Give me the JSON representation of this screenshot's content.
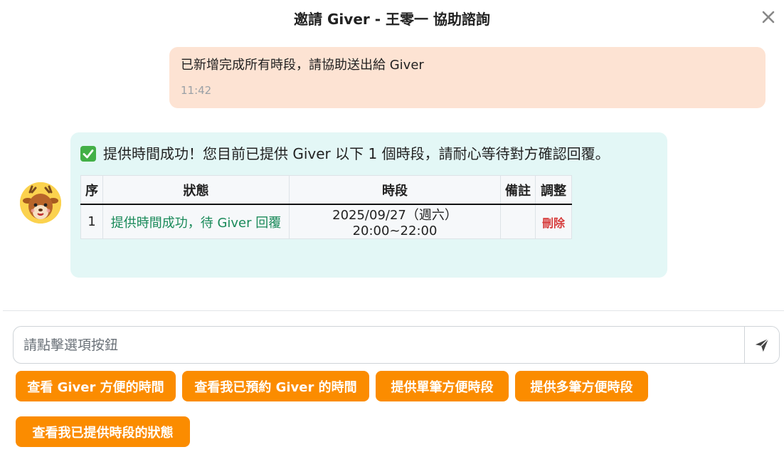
{
  "header": {
    "title": "邀請 Giver - 王零一 協助諮詢",
    "close_icon": "close-icon"
  },
  "messages": {
    "user": {
      "text": "已新增完成所有時段，請協助送出給 Giver",
      "time": "11:42"
    },
    "bot": {
      "avatar_icon": "deer-avatar-icon",
      "check_icon": "check-mark-icon",
      "text": "提供時間成功！您目前已提供 Giver 以下 1 個時段，請耐心等待對方確認回覆。",
      "table": {
        "headers": [
          "序",
          "狀態",
          "時段",
          "備註",
          "調整"
        ],
        "rows": [
          {
            "index": "1",
            "status": "提供時間成功，待 Giver 回覆",
            "slot": "2025/09/27（週六）20:00~22:00",
            "note": "",
            "action": "刪除"
          }
        ]
      }
    }
  },
  "input": {
    "placeholder": "請點擊選項按鈕",
    "value": "",
    "send_icon": "send-icon"
  },
  "options": [
    "查看 Giver 方便的時間",
    "查看我已預約 Giver 的時間",
    "提供單筆方便時段",
    "提供多筆方便時段",
    "查看我已提供時段的狀態"
  ],
  "colors": {
    "user_bubble": "#fde3d3",
    "bot_bubble": "#e3f7f6",
    "option_button": "#fb8c00",
    "status_green": "#1a8a5a",
    "delete_red": "#d63b3b"
  }
}
